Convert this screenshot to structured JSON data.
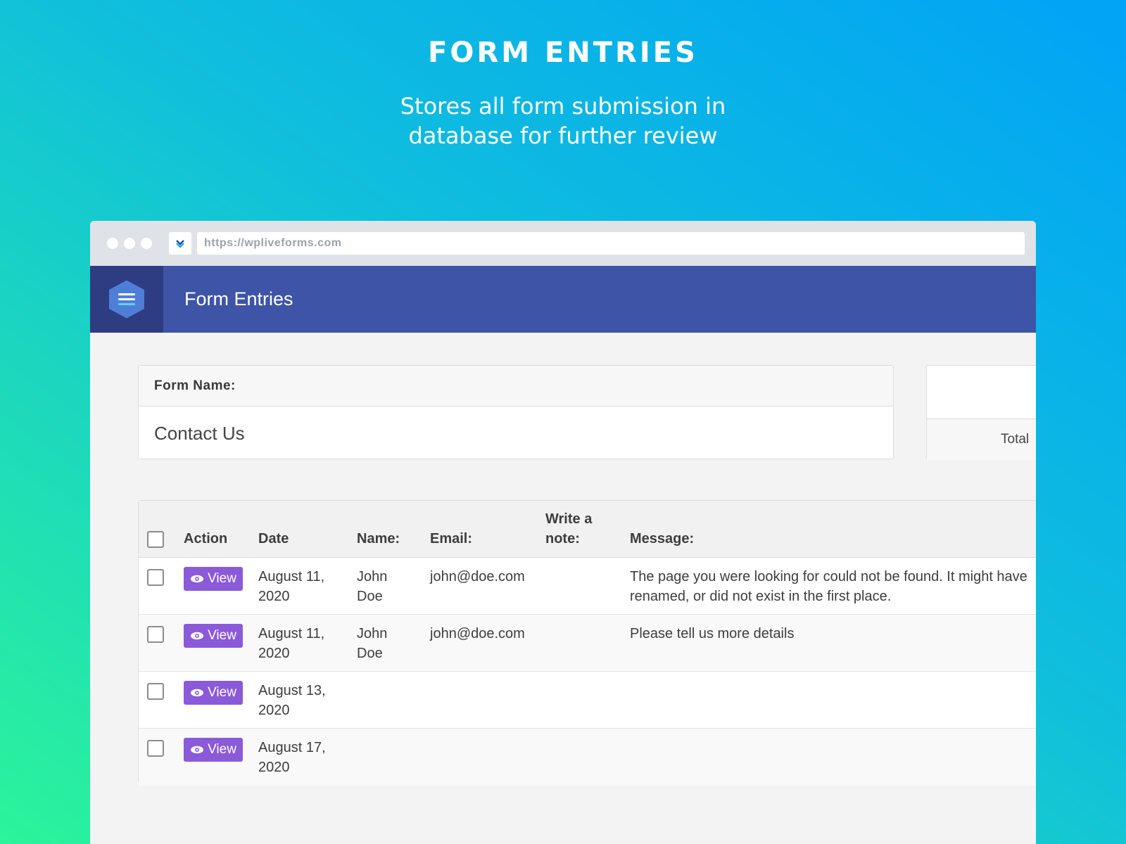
{
  "hero": {
    "title": "FORM ENTRIES",
    "subtitle": "Stores all form submission in database for further review"
  },
  "browser": {
    "url": "https://wpliveforms.com",
    "favicon": "chevron-logo-icon"
  },
  "app": {
    "logo_icon": "menu-hexagon-icon",
    "title": "Form Entries"
  },
  "form_card": {
    "label": "Form Name:",
    "value": "Contact Us"
  },
  "total_card": {
    "label": "Total"
  },
  "table": {
    "headers": {
      "action": "Action",
      "date": "Date",
      "name": "Name:",
      "email": "Email:",
      "note": "Write a note:",
      "message": "Message:"
    },
    "view_label": "View",
    "view_icon": "eye-icon",
    "rows": [
      {
        "date": "August 11, 2020",
        "name": "John Doe",
        "email": "john@doe.com",
        "note": "",
        "message": "The page you were looking for could not be found. It might have renamed, or did not exist in the first place."
      },
      {
        "date": "August 11, 2020",
        "name": "John Doe",
        "email": "john@doe.com",
        "note": "",
        "message": "Please tell us more details"
      },
      {
        "date": "August 13, 2020",
        "name": "",
        "email": "",
        "note": "",
        "message": ""
      },
      {
        "date": "August 17, 2020",
        "name": "",
        "email": "",
        "note": "",
        "message": ""
      }
    ]
  },
  "colors": {
    "header": "#3e54a7",
    "logo_bg": "#2e3d82",
    "view_button": "#8b5ad8",
    "gradient_top": "#01a3f6",
    "gradient_bottom": "#2bf49a"
  }
}
